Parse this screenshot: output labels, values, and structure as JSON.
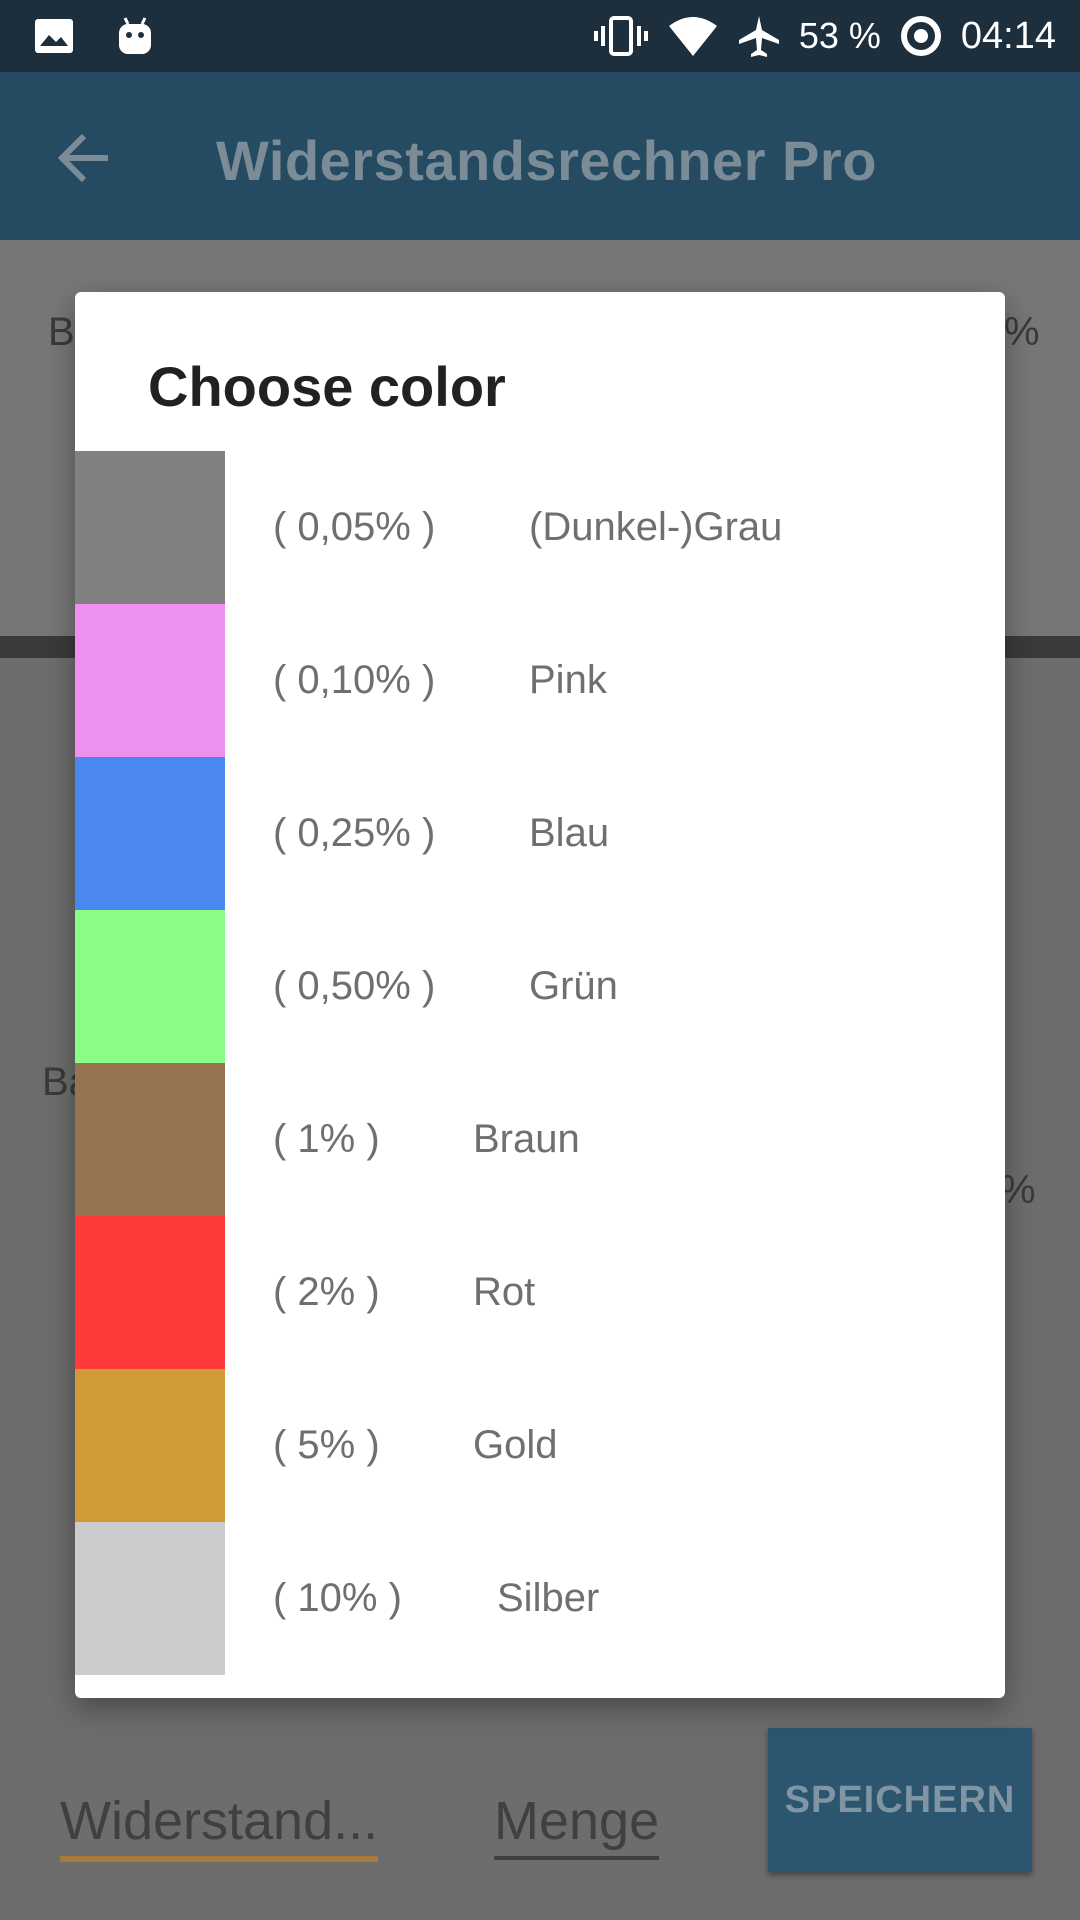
{
  "status_bar": {
    "battery_percent": "53 %",
    "time": "04:14",
    "icons": [
      "image-icon",
      "android-icon",
      "vibrate-icon",
      "wifi-icon",
      "airplane-icon",
      "data-saver-icon"
    ]
  },
  "app_bar": {
    "title": "Widerstandsrechner Pro",
    "back_icon": "arrow-back-icon",
    "background_color": "#2a5470"
  },
  "dialog": {
    "title": "Choose color",
    "options": [
      {
        "tolerance": "( 0,05% )",
        "name": "(Dunkel-)Grau",
        "color": "#808080"
      },
      {
        "tolerance": "( 0,10% )",
        "name": "Pink",
        "color": "#ee90f0"
      },
      {
        "tolerance": "( 0,25% )",
        "name": "Blau",
        "color": "#4a88f0"
      },
      {
        "tolerance": "( 0,50% )",
        "name": "Grün",
        "color": "#8bfd87"
      },
      {
        "tolerance": "( 1% )",
        "name": "Braun",
        "color": "#977452"
      },
      {
        "tolerance": "( 2% )",
        "name": "Rot",
        "color": "#ff3a3a"
      },
      {
        "tolerance": "( 5% )",
        "name": "Gold",
        "color": "#cf9b37"
      },
      {
        "tolerance": "( 10% )",
        "name": "Silber",
        "color": "#cccccc"
      }
    ]
  },
  "background": {
    "partial_labels": [
      "B",
      "%",
      "Ba",
      "%"
    ],
    "widerstand_field": "Widerstand...",
    "menge_field": "Menge",
    "save_label": "SPEICHERN"
  }
}
